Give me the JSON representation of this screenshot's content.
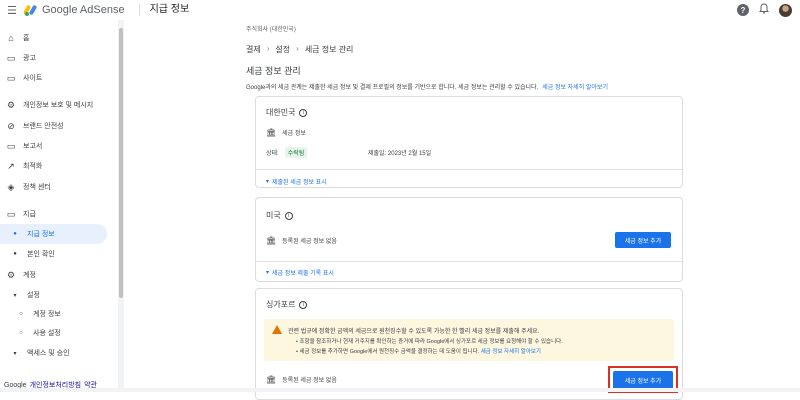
{
  "header": {
    "app_name": "Google AdSense",
    "page_name": "지급 정보",
    "help_icon": "?",
    "menu_icon": "☰",
    "bell_icon": "🔔"
  },
  "sidebar": {
    "items": [
      {
        "icon": "⌂",
        "label": "홈"
      },
      {
        "icon": "▭",
        "label": "광고"
      },
      {
        "icon": "▭",
        "label": "사이트"
      },
      {
        "icon": "⚙",
        "label": "개인정보 보호 및 메시지"
      },
      {
        "icon": "⊘",
        "label": "브랜드 안전성"
      },
      {
        "icon": "▭",
        "label": "보고서"
      },
      {
        "icon": "↗",
        "label": "최적화"
      },
      {
        "icon": "◈",
        "label": "정책 센터"
      },
      {
        "icon": "▭",
        "label": "지급"
      },
      {
        "icon": "●",
        "label": "지급 정보"
      },
      {
        "icon": "●",
        "label": "본인 확인"
      },
      {
        "icon": "⚙",
        "label": "계정"
      },
      {
        "icon": "▾",
        "label": "설정"
      },
      {
        "icon": "○",
        "label": "계정 정보"
      },
      {
        "icon": "○",
        "label": "사용 설정"
      },
      {
        "icon": "▾",
        "label": "액세스 및 승인"
      }
    ],
    "footer": {
      "brand": "Google",
      "privacy": "개인정보처리방침",
      "terms": "약관"
    }
  },
  "main": {
    "org": "주식회사 (대한민국)",
    "breadcrumb": [
      "결제",
      "설정",
      "세금 정보 관리"
    ],
    "title": "세금 정보 관리",
    "description": "Google과의 세금 관계는 제출한 세금 정보 및 결제 프로필의 정보를 기반으로 합니다. 세금 정보는 관리할 수 있습니다.",
    "description_link": "세금 정보 자세히 알아보기",
    "cards": {
      "korea": {
        "title": "대한민국",
        "tax_label": "세금 정보",
        "status_label": "상태:",
        "status_value": "수락됨",
        "submitted": "제출일: 2023년 2월 15일",
        "expand": "제출된 세금 정보 표시"
      },
      "us": {
        "title": "미국",
        "row": "등록된 세금 정보 없음",
        "button": "세금 정보 추가",
        "expand": "세금 정보 제출 기록 표시"
      },
      "singapore": {
        "title": "싱가포르",
        "warning": "관련 법규에 정확한 금액의 세금으로 원천징수할 수 있도록 가능한 한 빨리 세금 정보를 제출해 주세요.",
        "bullet1": "• 조항을 참조하거나 현재 거주지를 확인하는 증거에 따라 Google에서 싱가포르 세금 정보를 요청해야 할 수 있습니다.",
        "bullet2": "• 세금 정보를 추가하면 Google에서 원천징수 금액을 결정하는 데 도움이 됩니다.",
        "bullet2_link": "세금 정보 자세히 알아보기",
        "row": "등록된 세금 정보 없음",
        "button": "세금 정보 추가"
      }
    }
  }
}
